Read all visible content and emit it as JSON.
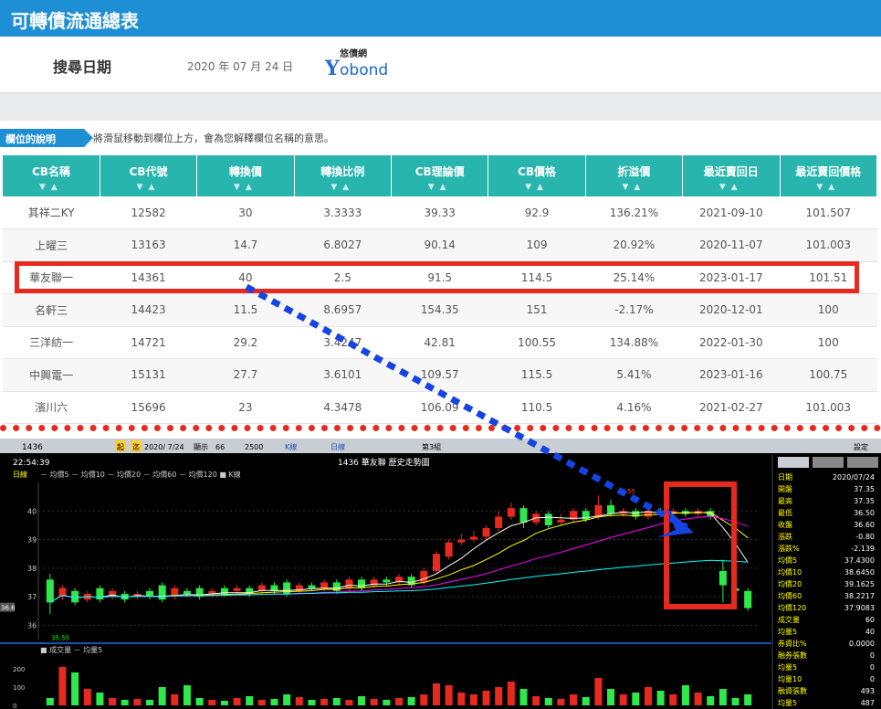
{
  "header": {
    "title": "可轉債流通總表"
  },
  "search": {
    "label": "搜尋日期",
    "date": "2020 年 07 月 24 日"
  },
  "logo": {
    "cn": "悠債網",
    "y": "Y",
    "bond": "obond"
  },
  "note": {
    "tag": "欄位的說明",
    "text": "將滑鼠移動到欄位上方，會為您解釋欄位名稱的意思。"
  },
  "table": {
    "columns": [
      "CB名稱",
      "CB代號",
      "轉換價",
      "轉換比例",
      "CB理論價",
      "CB價格",
      "折溢價",
      "最近賣回日",
      "最近賣回價格"
    ],
    "sort_glyph": "▼▲",
    "rows": [
      [
        "其祥二KY",
        "12582",
        "30",
        "3.3333",
        "39.33",
        "92.9",
        "136.21%",
        "2021-09-10",
        "101.507"
      ],
      [
        "上曜三",
        "13163",
        "14.7",
        "6.8027",
        "90.14",
        "109",
        "20.92%",
        "2020-11-07",
        "101.003"
      ],
      [
        "華友聯一",
        "14361",
        "40",
        "2.5",
        "91.5",
        "114.5",
        "25.14%",
        "2023-01-17",
        "101.51"
      ],
      [
        "名軒三",
        "14423",
        "11.5",
        "8.6957",
        "154.35",
        "151",
        "-2.17%",
        "2020-12-01",
        "100"
      ],
      [
        "三洋紡一",
        "14721",
        "29.2",
        "3.4247",
        "42.81",
        "100.55",
        "134.88%",
        "2022-01-30",
        "100"
      ],
      [
        "中興電一",
        "15131",
        "27.7",
        "3.6101",
        "109.57",
        "115.5",
        "5.41%",
        "2023-01-16",
        "100.75"
      ],
      [
        "濱川六",
        "15696",
        "23",
        "4.3478",
        "106.09",
        "110.5",
        "4.16%",
        "2021-02-27",
        "101.003"
      ]
    ]
  },
  "toolbar": {
    "code": "1436",
    "date": "2020/ 7/24",
    "display_label": "顯示",
    "display_value": "66",
    "total": "2500",
    "k_btn": "K線",
    "day_btn": "日線",
    "tab_btn": "第3組",
    "settings": "設定",
    "start": "起",
    "end": "迄"
  },
  "chart": {
    "time": "22:54:39",
    "title": "1436 華友聯 歷史走勢圖",
    "period": "日線",
    "legend": "－ 均價5 － 均價10 － 均價20 － 均價60 － 均價120 ■ K線",
    "y_ticks": [
      "40",
      "39",
      "38",
      "37",
      "36"
    ],
    "last": "36.6",
    "low_label": "35.55",
    "high_label": "40.55",
    "vol_legend": "■ 成交量 － 均量5",
    "vol_ticks": [
      "200",
      "100",
      "0"
    ]
  },
  "chart_data": {
    "type": "candlestick",
    "title": "1436 華友聯 歷史走勢圖",
    "ylim": [
      35.5,
      41.0
    ],
    "vol_ylim": [
      0,
      260
    ],
    "candles": [
      {
        "o": 37.6,
        "c": 36.8,
        "h": 37.8,
        "l": 36.4,
        "v": 40
      },
      {
        "o": 37.0,
        "c": 37.3,
        "h": 37.4,
        "l": 36.9,
        "v": 210
      },
      {
        "o": 37.2,
        "c": 36.8,
        "h": 37.3,
        "l": 36.7,
        "v": 180
      },
      {
        "o": 36.9,
        "c": 37.1,
        "h": 37.2,
        "l": 36.8,
        "v": 90
      },
      {
        "o": 37.3,
        "c": 36.9,
        "h": 37.4,
        "l": 36.8,
        "v": 70
      },
      {
        "o": 37.0,
        "c": 37.2,
        "h": 37.3,
        "l": 36.9,
        "v": 40
      },
      {
        "o": 37.1,
        "c": 36.9,
        "h": 37.2,
        "l": 36.8,
        "v": 30
      },
      {
        "o": 37.0,
        "c": 37.1,
        "h": 37.2,
        "l": 36.9,
        "v": 35
      },
      {
        "o": 37.2,
        "c": 37.0,
        "h": 37.3,
        "l": 36.9,
        "v": 30
      },
      {
        "o": 37.4,
        "c": 36.9,
        "h": 37.5,
        "l": 36.8,
        "v": 100
      },
      {
        "o": 37.0,
        "c": 37.3,
        "h": 37.4,
        "l": 36.9,
        "v": 60
      },
      {
        "o": 37.2,
        "c": 37.1,
        "h": 37.3,
        "l": 37.0,
        "v": 110
      },
      {
        "o": 37.3,
        "c": 37.0,
        "h": 37.4,
        "l": 36.9,
        "v": 40
      },
      {
        "o": 37.1,
        "c": 37.2,
        "h": 37.3,
        "l": 37.0,
        "v": 30
      },
      {
        "o": 37.3,
        "c": 37.1,
        "h": 37.4,
        "l": 37.0,
        "v": 25
      },
      {
        "o": 37.2,
        "c": 37.3,
        "h": 37.4,
        "l": 37.1,
        "v": 40
      },
      {
        "o": 37.3,
        "c": 37.1,
        "h": 37.4,
        "l": 37.0,
        "v": 50
      },
      {
        "o": 37.2,
        "c": 37.4,
        "h": 37.5,
        "l": 37.1,
        "v": 30
      },
      {
        "o": 37.4,
        "c": 37.2,
        "h": 37.5,
        "l": 37.1,
        "v": 35
      },
      {
        "o": 37.5,
        "c": 37.1,
        "h": 37.6,
        "l": 37.0,
        "v": 60
      },
      {
        "o": 37.2,
        "c": 37.4,
        "h": 37.5,
        "l": 37.1,
        "v": 45
      },
      {
        "o": 37.4,
        "c": 37.3,
        "h": 37.5,
        "l": 37.2,
        "v": 30
      },
      {
        "o": 37.3,
        "c": 37.5,
        "h": 37.6,
        "l": 37.2,
        "v": 35
      },
      {
        "o": 37.5,
        "c": 37.2,
        "h": 37.6,
        "l": 37.1,
        "v": 40
      },
      {
        "o": 37.3,
        "c": 37.6,
        "h": 37.7,
        "l": 37.2,
        "v": 30
      },
      {
        "o": 37.6,
        "c": 37.3,
        "h": 37.7,
        "l": 37.2,
        "v": 50
      },
      {
        "o": 37.4,
        "c": 37.6,
        "h": 37.7,
        "l": 37.3,
        "v": 35
      },
      {
        "o": 37.6,
        "c": 37.5,
        "h": 37.7,
        "l": 37.4,
        "v": 30
      },
      {
        "o": 37.5,
        "c": 37.7,
        "h": 37.8,
        "l": 37.4,
        "v": 40
      },
      {
        "o": 37.7,
        "c": 37.4,
        "h": 37.8,
        "l": 37.3,
        "v": 45
      },
      {
        "o": 37.5,
        "c": 37.9,
        "h": 38.0,
        "l": 37.4,
        "v": 60
      },
      {
        "o": 37.9,
        "c": 38.5,
        "h": 38.6,
        "l": 37.8,
        "v": 120
      },
      {
        "o": 38.4,
        "c": 38.9,
        "h": 39.0,
        "l": 38.3,
        "v": 110
      },
      {
        "o": 38.9,
        "c": 39.0,
        "h": 39.2,
        "l": 38.8,
        "v": 70
      },
      {
        "o": 39.0,
        "c": 39.1,
        "h": 39.3,
        "l": 38.9,
        "v": 60
      },
      {
        "o": 39.1,
        "c": 39.4,
        "h": 39.5,
        "l": 39.0,
        "v": 80
      },
      {
        "o": 39.4,
        "c": 39.8,
        "h": 40.0,
        "l": 39.3,
        "v": 100
      },
      {
        "o": 39.8,
        "c": 40.1,
        "h": 40.3,
        "l": 39.7,
        "v": 130
      },
      {
        "o": 40.1,
        "c": 39.6,
        "h": 40.2,
        "l": 39.4,
        "v": 90
      },
      {
        "o": 39.6,
        "c": 39.9,
        "h": 40.0,
        "l": 39.5,
        "v": 50
      },
      {
        "o": 39.9,
        "c": 39.5,
        "h": 40.0,
        "l": 39.4,
        "v": 40
      },
      {
        "o": 39.6,
        "c": 39.7,
        "h": 39.9,
        "l": 39.5,
        "v": 35
      },
      {
        "o": 39.7,
        "c": 40.0,
        "h": 40.1,
        "l": 39.6,
        "v": 60
      },
      {
        "o": 40.0,
        "c": 39.7,
        "h": 40.1,
        "l": 39.6,
        "v": 45
      },
      {
        "o": 39.8,
        "c": 40.2,
        "h": 40.55,
        "l": 39.7,
        "v": 150
      },
      {
        "o": 40.2,
        "c": 39.9,
        "h": 40.4,
        "l": 39.8,
        "v": 90
      },
      {
        "o": 39.9,
        "c": 40.0,
        "h": 40.1,
        "l": 39.8,
        "v": 60
      },
      {
        "o": 40.0,
        "c": 39.8,
        "h": 40.1,
        "l": 39.7,
        "v": 70
      },
      {
        "o": 39.8,
        "c": 40.0,
        "h": 40.1,
        "l": 39.7,
        "v": 100
      },
      {
        "o": 40.0,
        "c": 39.9,
        "h": 40.1,
        "l": 39.8,
        "v": 80
      },
      {
        "o": 39.9,
        "c": 40.0,
        "h": 40.1,
        "l": 39.8,
        "v": 60
      },
      {
        "o": 40.0,
        "c": 39.9,
        "h": 40.1,
        "l": 39.8,
        "v": 110
      },
      {
        "o": 39.9,
        "c": 40.0,
        "h": 40.1,
        "l": 39.8,
        "v": 70
      },
      {
        "o": 40.0,
        "c": 39.8,
        "h": 40.1,
        "l": 39.7,
        "v": 50
      },
      {
        "o": 37.9,
        "c": 37.4,
        "h": 38.3,
        "l": 36.8,
        "v": 90
      },
      {
        "o": 37.3,
        "c": 37.2,
        "h": 37.6,
        "l": 37.0,
        "v": 40
      },
      {
        "o": 37.2,
        "c": 36.6,
        "h": 37.3,
        "l": 36.5,
        "v": 60
      }
    ]
  }
}
